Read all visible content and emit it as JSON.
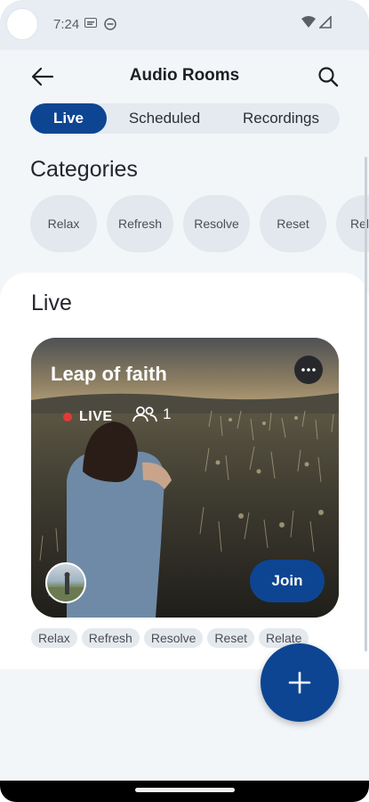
{
  "status": {
    "time": "7:24"
  },
  "header": {
    "title": "Audio Rooms"
  },
  "tabs": [
    {
      "label": "Live",
      "active": true
    },
    {
      "label": "Scheduled",
      "active": false
    },
    {
      "label": "Recordings",
      "active": false
    }
  ],
  "categories": {
    "title": "Categories",
    "items": [
      "Relax",
      "Refresh",
      "Resolve",
      "Reset",
      "Rela"
    ]
  },
  "live": {
    "title": "Live",
    "room": {
      "title": "Leap of faith",
      "badge": "LIVE",
      "listeners": "1",
      "join_label": "Join",
      "tags": [
        "Relax",
        "Refresh",
        "Resolve",
        "Reset",
        "Relate"
      ]
    }
  },
  "fab": {
    "icon": "plus-icon"
  },
  "colors": {
    "accent": "#0d4592",
    "live_dot": "#e53935"
  }
}
